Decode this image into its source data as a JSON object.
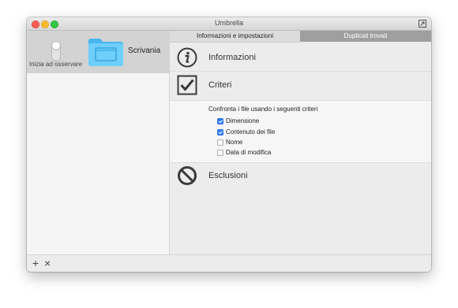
{
  "window": {
    "title": "Umbrella"
  },
  "sidebar": {
    "toggle_label": "Inizia ad osservare",
    "folder_label": "Scrivania"
  },
  "tabs": [
    {
      "label": "Informazioni e impostazioni",
      "selected": true
    },
    {
      "label": "Duplicati trovati",
      "selected": false
    }
  ],
  "sections": {
    "info": {
      "label": "Informazioni",
      "icon": "info-icon"
    },
    "criteria": {
      "label": "Criteri",
      "icon": "checkmark-icon"
    },
    "exclusions": {
      "label": "Esclusioni",
      "icon": "prohibited-icon"
    }
  },
  "criteria": {
    "heading": "Confronta i file usando i seguenti criteri",
    "options": [
      {
        "label": "Dimensione",
        "checked": true
      },
      {
        "label": "Contenuto dei file",
        "checked": true
      },
      {
        "label": "Nome",
        "checked": false
      },
      {
        "label": "Data di modifica",
        "checked": false
      }
    ]
  },
  "bottombar": {
    "add_label": "+",
    "remove_label": "×"
  },
  "colors": {
    "accent": "#2f7cf6",
    "folder": "#5ac8fa",
    "tab_inactive": "#9f9f9f"
  }
}
